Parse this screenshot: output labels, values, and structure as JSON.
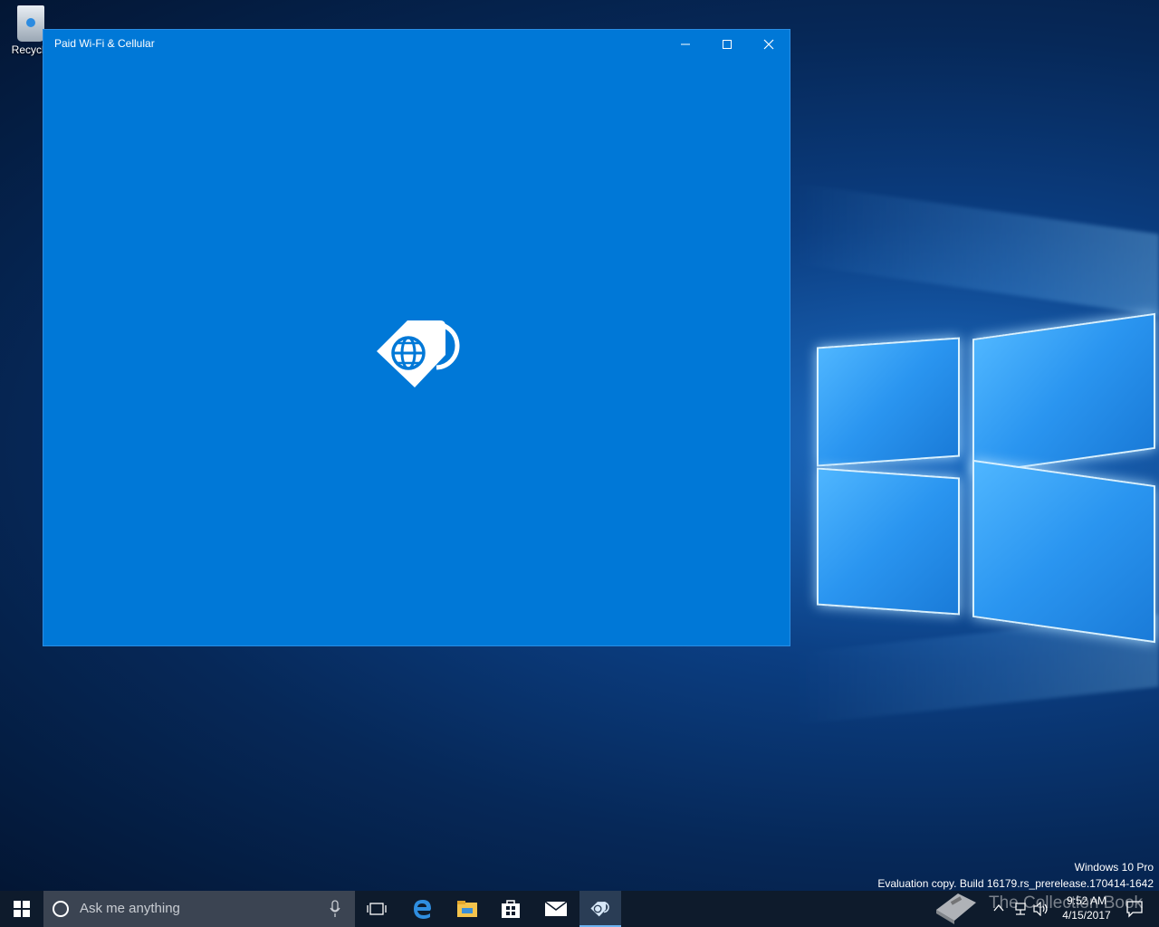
{
  "desktop": {
    "recycle_bin_label": "Recycle"
  },
  "app_window": {
    "title": "Paid Wi-Fi & Cellular",
    "accent_color": "#0078d7",
    "splash_icon": "sim-globe-tag-icon",
    "controls": {
      "minimize_icon": "minimize-icon",
      "maximize_icon": "maximize-icon",
      "close_icon": "close-icon"
    }
  },
  "watermark": {
    "edition": "Windows 10 Pro",
    "build": "Evaluation copy. Build 16179.rs_prerelease.170414-1642"
  },
  "taskbar": {
    "search_placeholder": "Ask me anything",
    "apps": [
      "task-view-icon",
      "edge-icon",
      "file-explorer-icon",
      "store-icon",
      "mail-icon",
      "paid-wifi-cellular-icon"
    ],
    "clock": {
      "time": "9:52 AM",
      "date": "4/15/2017"
    },
    "overlay_text": "The Collection Book"
  }
}
